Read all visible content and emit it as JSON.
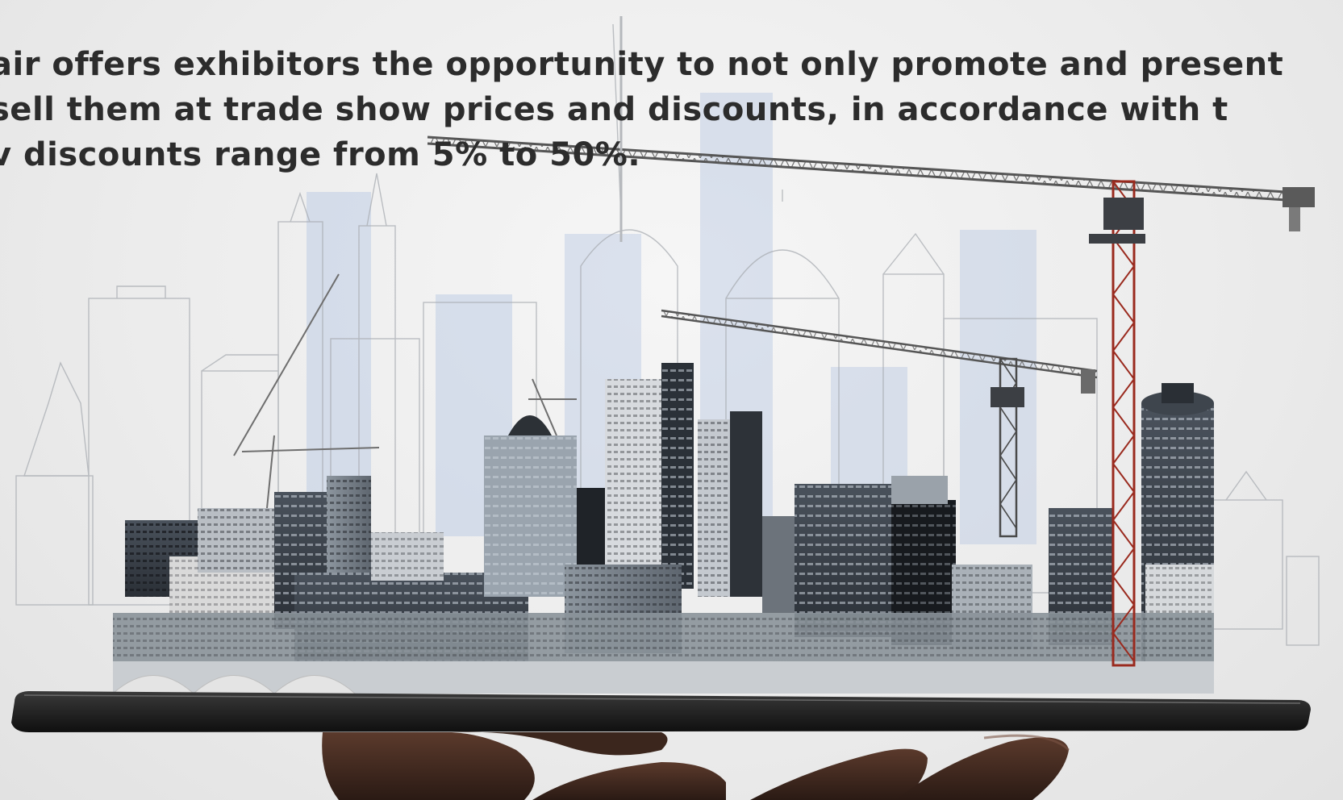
{
  "banner": {
    "text_lines": [
      "air offers exhibitors the opportunity to not only promote and present",
      " sell them at trade show prices and discounts, in accordance with t",
      "v discounts range from 5% to 50%."
    ]
  },
  "colors": {
    "background": "#ececec",
    "text": "#2c2c2c",
    "sketch_blue": "#b9c9e3",
    "crane_red": "#9a2a1e",
    "tablet": "#1c1c1c"
  },
  "icons": [
    "city-skyline-illustration",
    "tower-crane-illustration",
    "tablet-device",
    "hand-holding-tablet"
  ]
}
